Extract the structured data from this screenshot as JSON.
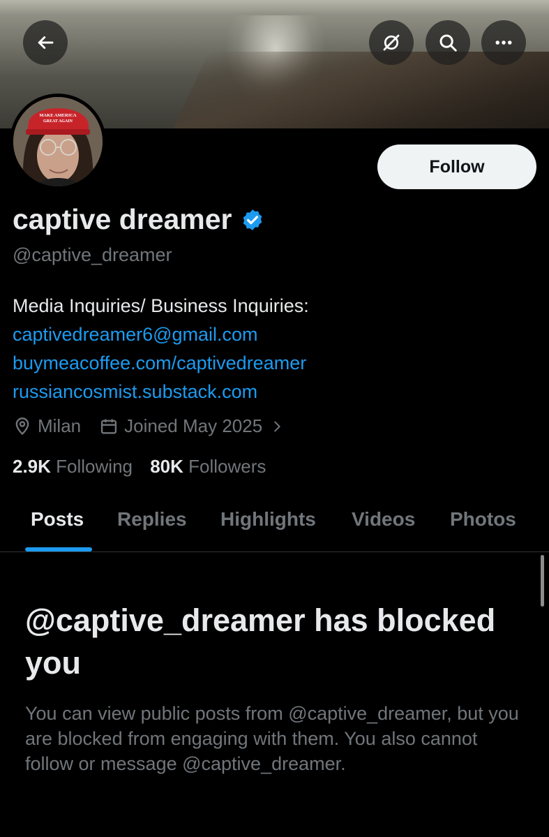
{
  "header": {
    "back_icon": "arrow-left-icon",
    "stop_icon": "no-sync-icon",
    "search_icon": "search-icon",
    "more_icon": "more-icon"
  },
  "profile": {
    "display_name": "captive dreamer",
    "handle": "@captive_dreamer",
    "verified": true,
    "follow_label": "Follow",
    "avatar_hat_text": "MAKE AMERICA GREAT AGAIN"
  },
  "bio": {
    "text": "Media Inquiries/ Business Inquiries:",
    "links": [
      "captivedreamer6@gmail.com",
      "buymeacoffee.com/captivedreamer",
      "russiancosmist.substack.com"
    ]
  },
  "meta": {
    "location": "Milan",
    "joined": "Joined May 2025"
  },
  "stats": {
    "following_count": "2.9K",
    "following_label": "Following",
    "followers_count": "80K",
    "followers_label": "Followers"
  },
  "tabs": [
    "Posts",
    "Replies",
    "Highlights",
    "Videos",
    "Photos"
  ],
  "active_tab": "Posts",
  "blocked": {
    "title": "@captive_dreamer has blocked you",
    "description": "You can view public posts from @captive_dreamer, but you are blocked from engaging with them. You also cannot follow or message @captive_dreamer."
  },
  "colors": {
    "accent": "#1d9bf0",
    "background": "#000000",
    "text_primary": "#e7e9ea",
    "text_secondary": "#71767b"
  }
}
